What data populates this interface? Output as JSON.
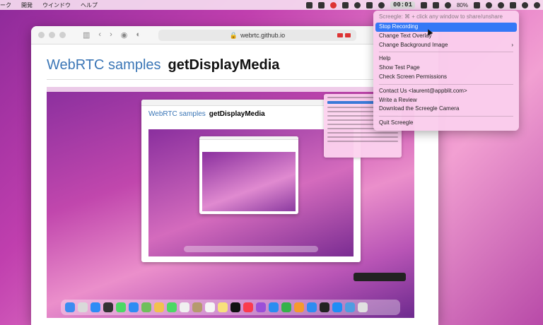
{
  "menubar": {
    "app_menus": [
      "ーク",
      "開発",
      "ウインドウ",
      "ヘルプ"
    ],
    "timer": "00:01",
    "battery": "80%"
  },
  "browser": {
    "url": "webrtc.github.io"
  },
  "page": {
    "crumb": "WebRTC samples",
    "title": "getDisplayMedia"
  },
  "screegle_menu": {
    "hint": "Screegle: ⌘ + click any window to share/unshare",
    "items": [
      {
        "label": "Stop Recording",
        "active": true
      },
      {
        "label": "Change Text Overlay"
      },
      {
        "label": "Change Background Image",
        "submenu_icon": "chevron-right-icon",
        "arrow": "›"
      }
    ],
    "items2": [
      {
        "label": "Help"
      },
      {
        "label": "Show Test Page"
      },
      {
        "label": "Check Screen Permissions"
      }
    ],
    "items3": [
      {
        "label": "Contact Us <laurent@appblit.com>"
      },
      {
        "label": "Write a Review"
      },
      {
        "label": "Download the Screegle Camera"
      }
    ],
    "items4": [
      {
        "label": "Quit Screegle"
      }
    ]
  },
  "colors": {
    "accent": "#3478f6",
    "link": "#3b76b6",
    "menu_bg": "#fad0ec"
  }
}
